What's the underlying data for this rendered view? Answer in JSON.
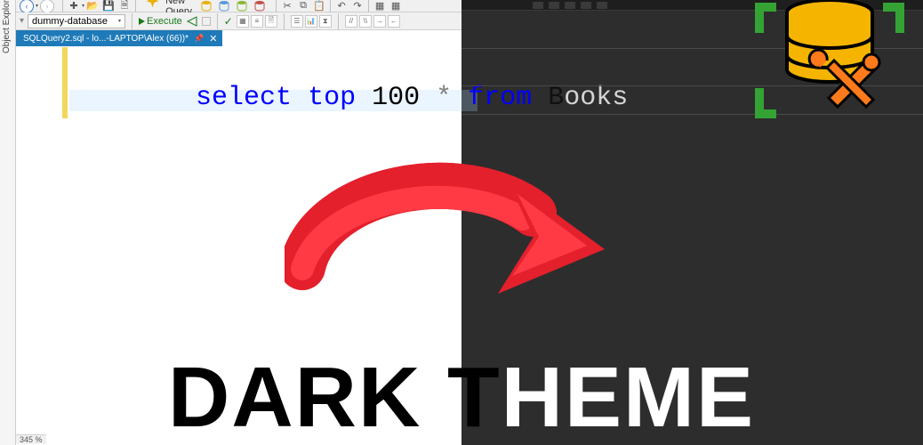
{
  "object_explorer_label": "Object Explorer",
  "toolbar": {
    "new_query_label": "New Query",
    "database_selected": "dummy-database",
    "execute_label": "Execute"
  },
  "tab": {
    "label": "SQLQuery2.sql - lo...-LAPTOP\\Alex (66))*",
    "close_glyph": "✕"
  },
  "code": {
    "kw_select": "select",
    "kw_top": "top",
    "literal_100": "100",
    "star": "*",
    "kw_from": "from",
    "ident_left_half": "B",
    "ident_right_half": "ooks"
  },
  "headline": {
    "left": "DARK T",
    "right": "HEME"
  },
  "status_zoom": "345 %",
  "icons": {
    "back": "‹",
    "fwd": "›",
    "chev": "▾",
    "plus": "✚",
    "open": "📂",
    "save": "💾",
    "saveall": "🗎",
    "undo": "↶",
    "redo": "↷",
    "cut": "✂",
    "copy": "⧉",
    "paste": "📋",
    "grid": "▦",
    "check": "✓"
  }
}
